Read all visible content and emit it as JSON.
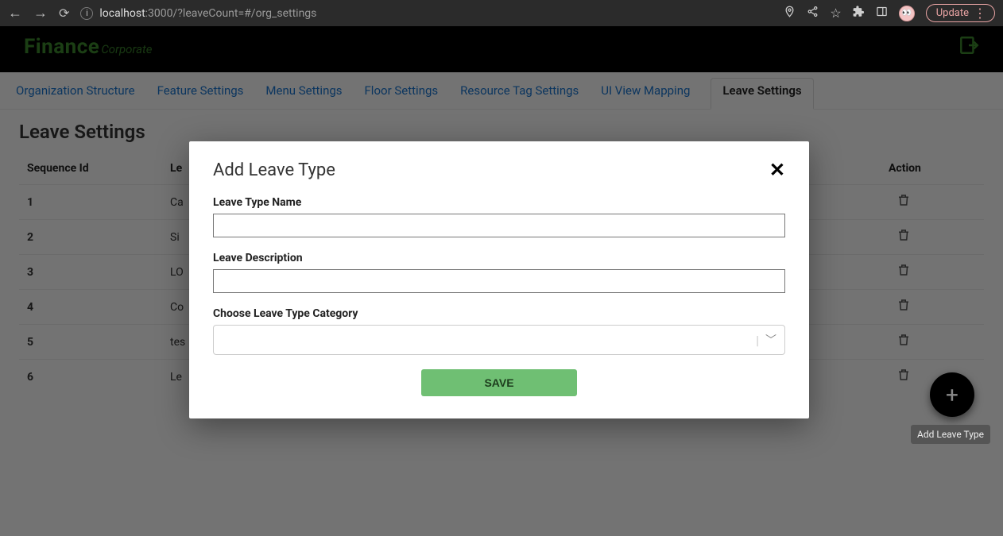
{
  "browser": {
    "url_host": "localhost",
    "url_rest": ":3000/?leaveCount=#/org_settings",
    "update_label": "Update"
  },
  "brand": {
    "main": "Finance",
    "sub": "Corporate"
  },
  "tabs": [
    {
      "label": "Organization Structure"
    },
    {
      "label": "Feature Settings"
    },
    {
      "label": "Menu Settings"
    },
    {
      "label": "Floor Settings"
    },
    {
      "label": "Resource Tag Settings"
    },
    {
      "label": "UI View Mapping"
    },
    {
      "label": "Leave Settings"
    }
  ],
  "page": {
    "title": "Leave Settings",
    "columns": {
      "seq": "Sequence Id",
      "leave": "Le",
      "action": "Action"
    },
    "rows": [
      {
        "seq": "1",
        "leave": "Ca"
      },
      {
        "seq": "2",
        "leave": "Si"
      },
      {
        "seq": "3",
        "leave": "LO"
      },
      {
        "seq": "4",
        "leave": "Co"
      },
      {
        "seq": "5",
        "leave": "tes"
      },
      {
        "seq": "6",
        "leave": "Le"
      }
    ]
  },
  "fab": {
    "tooltip": "Add Leave Type"
  },
  "modal": {
    "title": "Add Leave Type",
    "fields": {
      "name_label": "Leave Type Name",
      "desc_label": "Leave Description",
      "cat_label": "Choose Leave Type Category",
      "name_value": "",
      "desc_value": "",
      "cat_value": ""
    },
    "save_label": "SAVE"
  }
}
